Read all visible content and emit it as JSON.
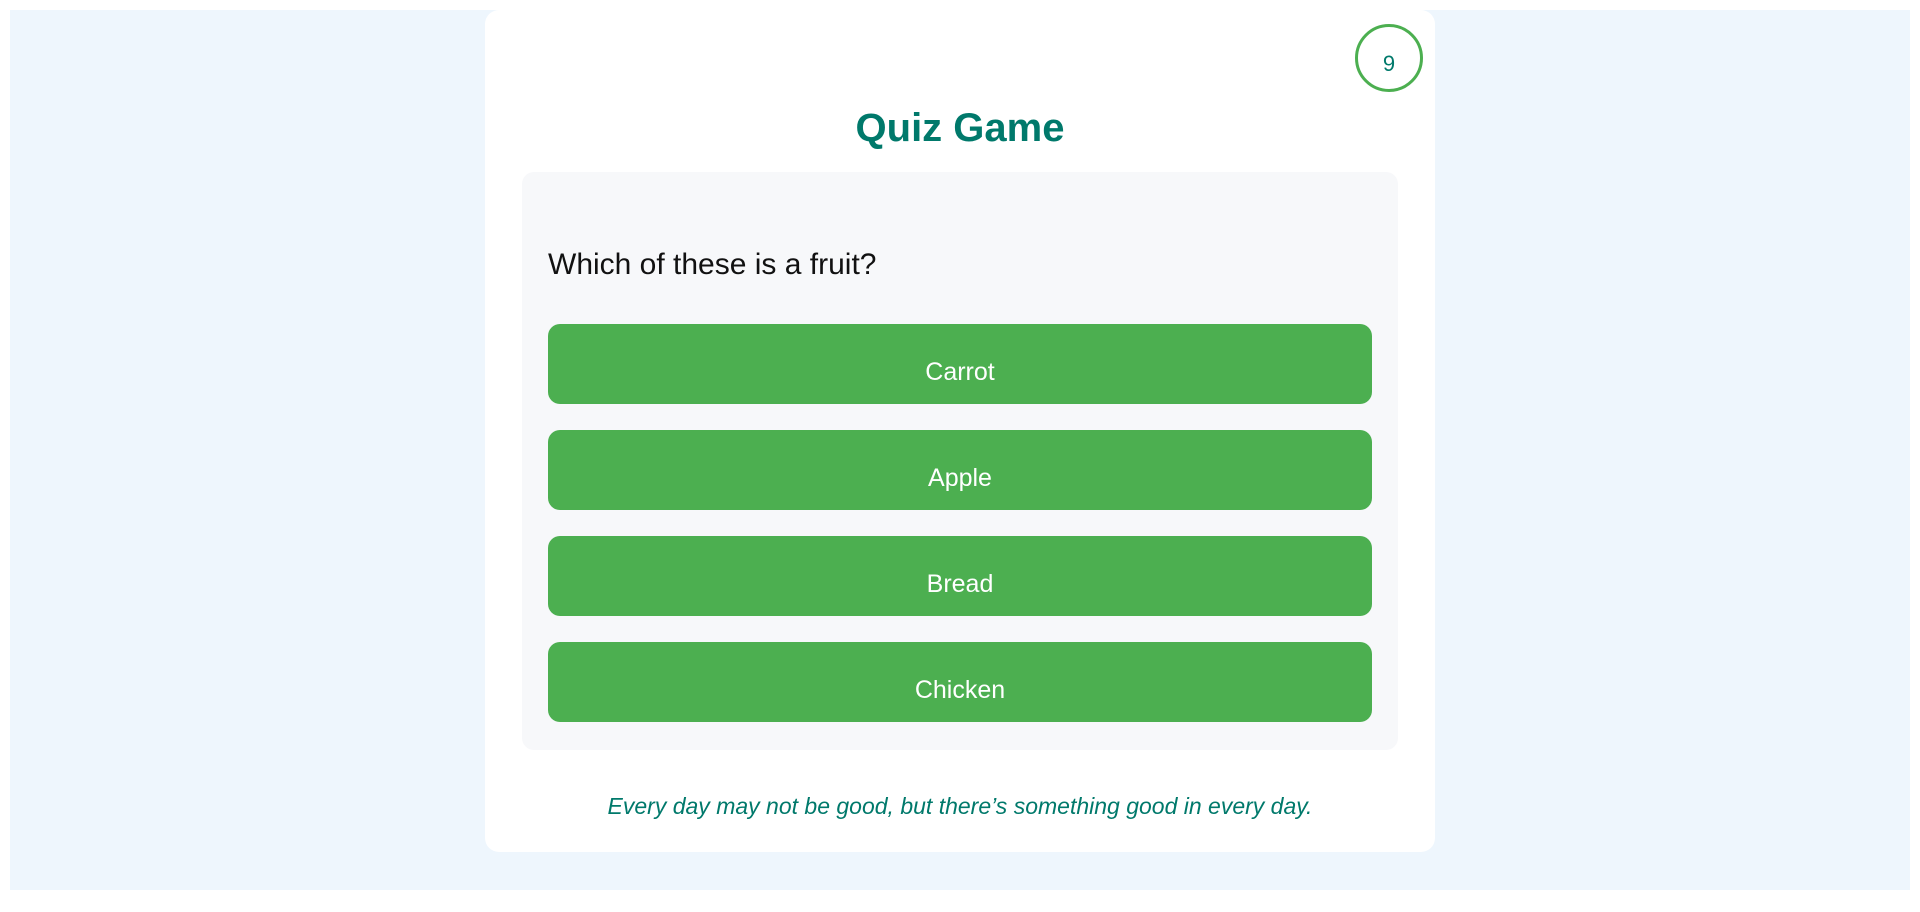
{
  "timer": {
    "value": "9"
  },
  "game": {
    "title": "Quiz Game"
  },
  "question": {
    "text": "Which of these is a fruit?",
    "answers": [
      {
        "label": "Carrot"
      },
      {
        "label": "Apple"
      },
      {
        "label": "Bread"
      },
      {
        "label": "Chicken"
      }
    ]
  },
  "footer": {
    "quote": "Every day may not be good, but there’s something good in every day."
  },
  "colors": {
    "accent": "#00796b",
    "button": "#4caf50",
    "page_background": "#eef6fd"
  }
}
